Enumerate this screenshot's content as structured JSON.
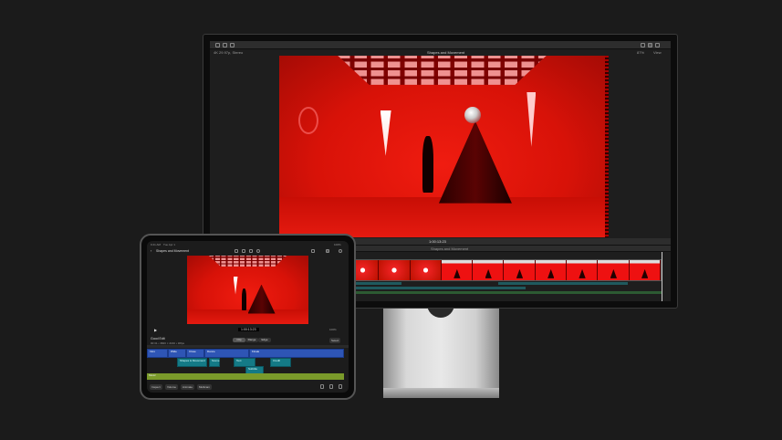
{
  "monitor": {
    "project_title": "Shapes and Movement",
    "top_left_info": "4K 29.97p, Stereo",
    "top_right_zoom": "87%",
    "top_right_view": "View",
    "timecode": "1:00:13:23",
    "timeline_project": "Shapes and Movement"
  },
  "ipad": {
    "status_time": "9:41 AM",
    "status_date": "Tue Apr 1",
    "battery": "100%",
    "project_title": "Shapes and Movement",
    "timecode": "1:00:13:23",
    "zoom": "100%",
    "info_title": "Good Edit",
    "info_detail": "00:31 • 3840 × 2160 • 30fps",
    "modes": [
      "Clip",
      "Range",
      "Edge"
    ],
    "select_label": "Select",
    "timeline_clips": [
      "Intro",
      "Wide",
      "Close",
      "Dance",
      "Finale"
    ],
    "title_clips": [
      "Shapes & Movement",
      "Scene",
      "Text",
      "Subtitle",
      "Credit"
    ],
    "audio_label": "Music",
    "bottom_buttons": [
      "Inspect",
      "Volume",
      "Animate",
      "Multicam"
    ]
  },
  "colors": {
    "accent_red": "#e8140a",
    "clip_blue": "#2e55b5",
    "clip_teal": "#147a86",
    "audio_green": "#7a9a2a"
  }
}
